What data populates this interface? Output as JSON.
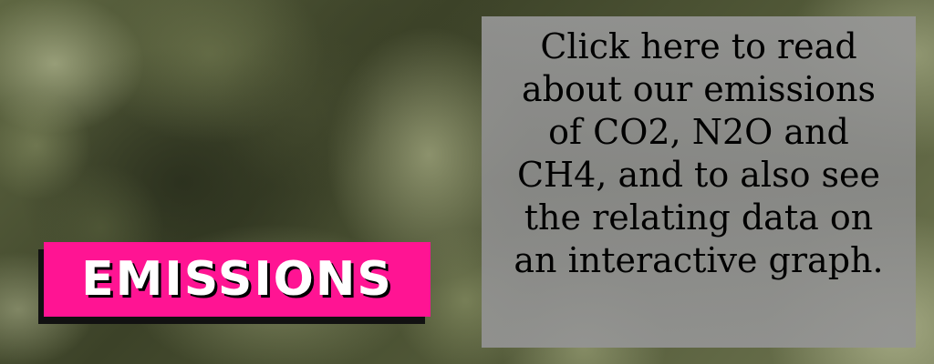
{
  "banner": {
    "tag_label": "EMISSIONS",
    "info_lines": [
      "Click here to read",
      "about our emissions",
      "of CO2, N2O and",
      "CH4, and to also see",
      "the relating data on",
      "an interactive graph."
    ]
  },
  "colors": {
    "tag_background": "#ff1493",
    "tag_text": "#ffffff",
    "info_box_background": "#8f8f8f",
    "info_text": "#000000"
  },
  "icons": {
    "background": "smoke-cloud-image"
  }
}
